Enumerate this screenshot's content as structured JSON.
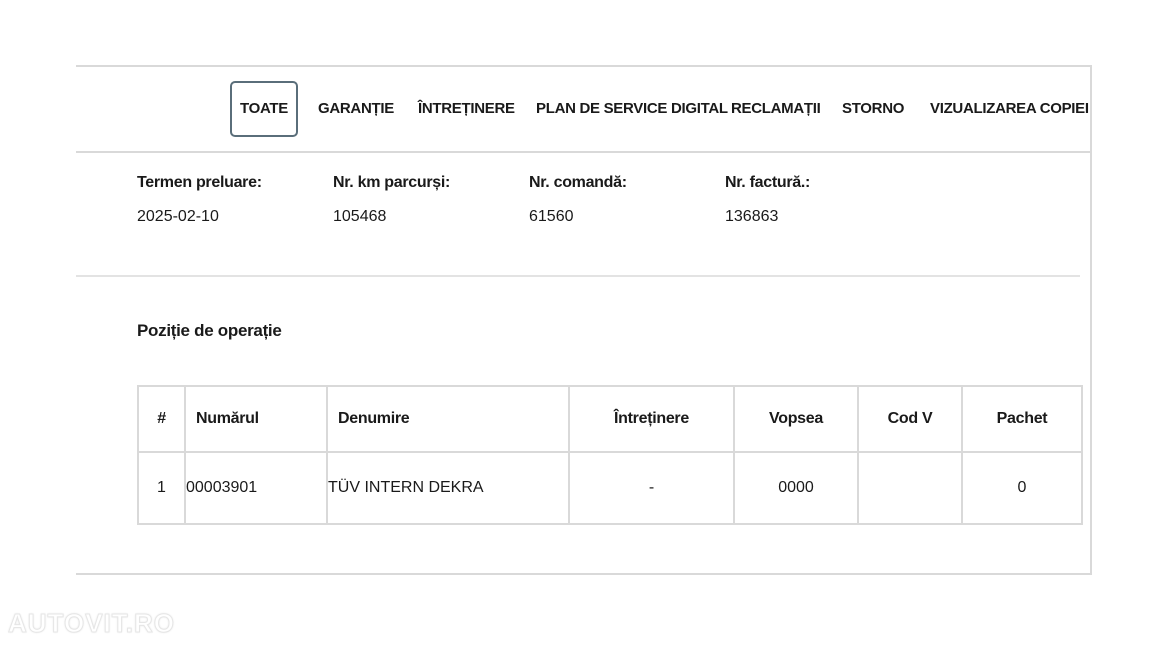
{
  "tabs": [
    {
      "label": "TOATE",
      "active": true
    },
    {
      "label": "GARANȚIE",
      "active": false
    },
    {
      "label": "ÎNTREȚINERE",
      "active": false
    },
    {
      "label": "PLAN DE SERVICE DIGITAL",
      "active": false
    },
    {
      "label": "RECLAMAȚII",
      "active": false
    },
    {
      "label": "STORNO",
      "active": false
    },
    {
      "label": "VIZUALIZAREA COPIEI",
      "active": false
    }
  ],
  "info": {
    "termen_preluare": {
      "label": "Termen preluare:",
      "value": "2025-02-10"
    },
    "nr_km": {
      "label": "Nr. km parcurși:",
      "value": "105468"
    },
    "nr_comanda": {
      "label": "Nr. comandă:",
      "value": "61560"
    },
    "nr_factura": {
      "label": "Nr. factură.:",
      "value": "136863"
    }
  },
  "section": {
    "title": "Poziție de operație"
  },
  "table": {
    "headers": [
      "#",
      "Numărul",
      "Denumire",
      "Întreținere",
      "Vopsea",
      "Cod V",
      "Pachet"
    ],
    "rows": [
      [
        "1",
        "00003901",
        "TÜV INTERN DEKRA",
        "-",
        "0000",
        "",
        "0"
      ]
    ]
  },
  "watermark": "AUTOVIT.RO",
  "colors": {
    "border": "#d9d9d9",
    "active_tab_border": "#5a6e7a",
    "text": "#1a1a1a"
  }
}
